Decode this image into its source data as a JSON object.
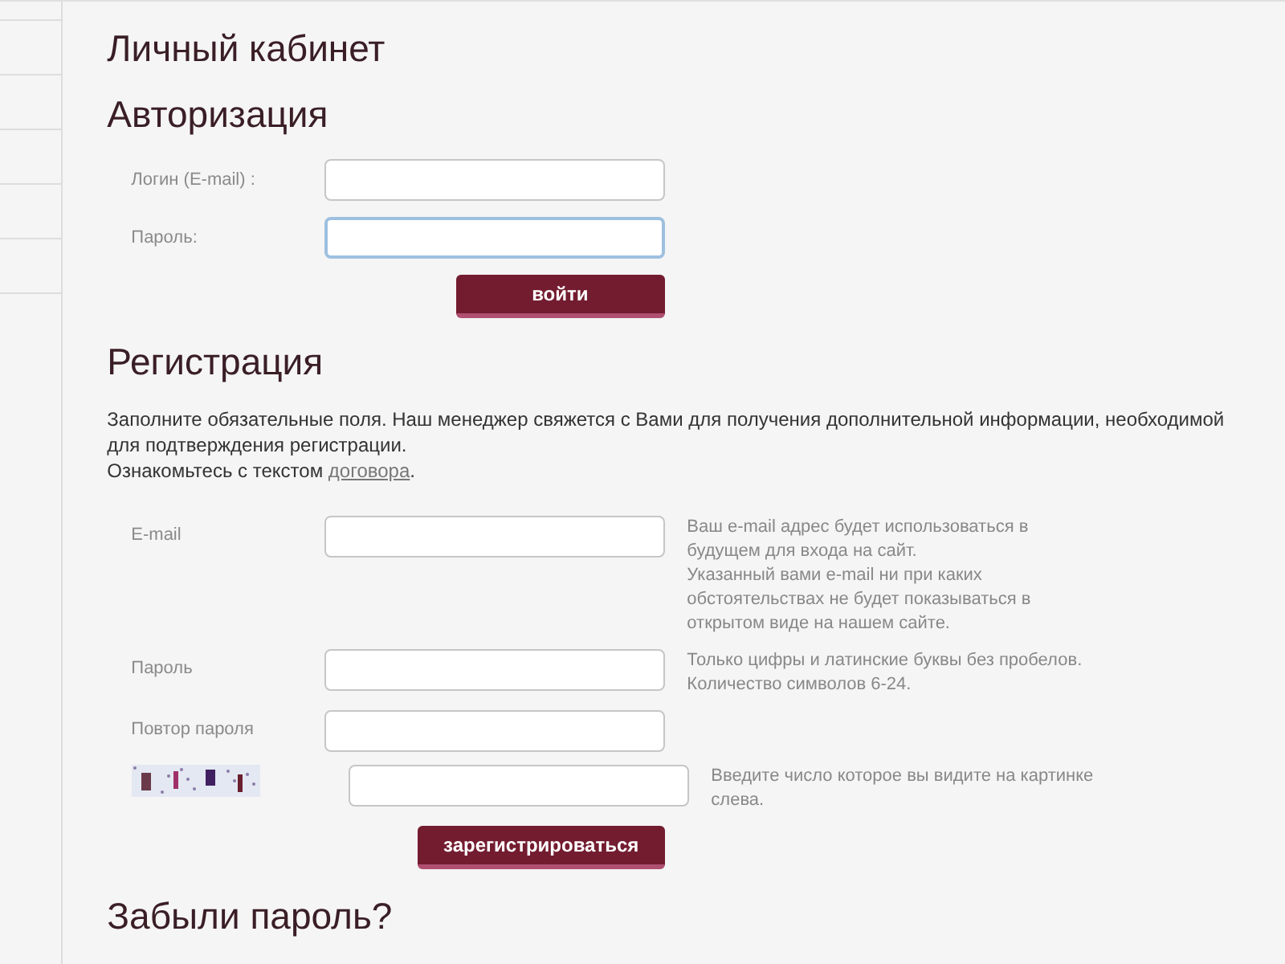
{
  "page_title": "Личный кабинет",
  "login": {
    "heading": "Авторизация",
    "fields": [
      {
        "label": "Логин (E-mail) :",
        "focused": false
      },
      {
        "label": "Пароль:",
        "focused": true
      }
    ],
    "button": "войти"
  },
  "registration": {
    "heading": "Регистрация",
    "intro": "Заполните обязательные поля. Наш менеджер свяжется с Вами для получения дополнительной информации, необходимой для подтверждения регистрации.",
    "contract_text": "Ознакомьтесь с текстом ",
    "contract_link": "договора",
    "contract_end": ".",
    "fields": [
      {
        "kind": "text",
        "label": "E-mail",
        "hint": [
          "Ваш e-mail адрес будет использоваться в будущем для входа на сайт.",
          "Указанный вами e-mail ни при каких обстоятельствах не будет показываться в открытом виде на нашем сайте."
        ]
      },
      {
        "kind": "text",
        "label": "Пароль",
        "hint": [
          "Только цифры и латинские буквы без пробелов.",
          "Количество символов 6-24."
        ]
      },
      {
        "kind": "text",
        "label": "Повтор пароля"
      },
      {
        "kind": "captcha",
        "hint": [
          "Введите число которое вы видите на картинке слева."
        ]
      }
    ],
    "button": "зарегистрироваться"
  },
  "forgot_heading": "Забыли пароль?"
}
